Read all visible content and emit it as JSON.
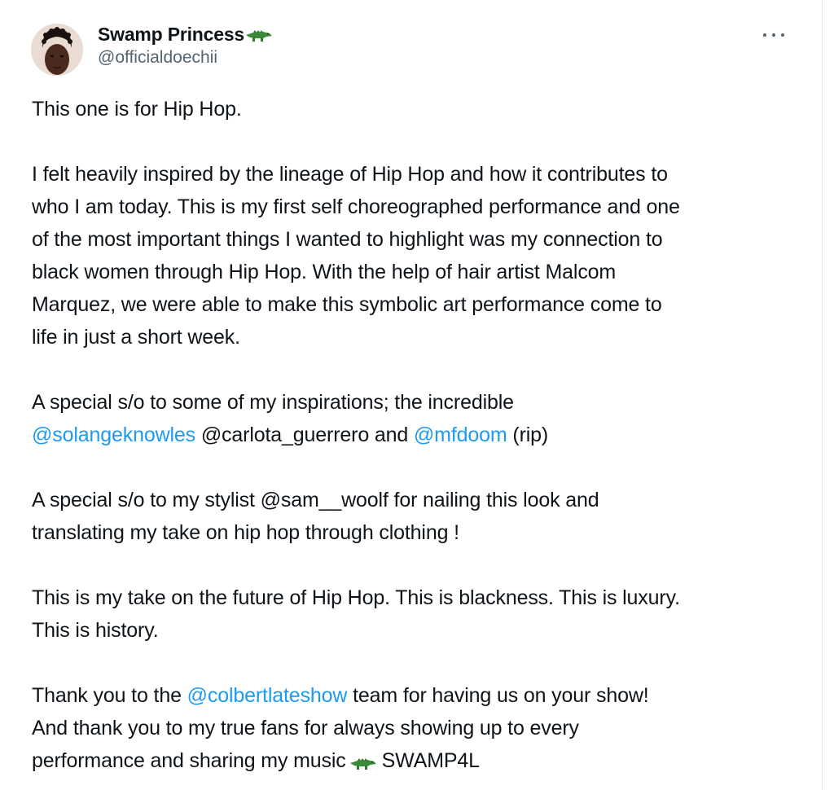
{
  "author": {
    "display_name": "Swamp Princess",
    "name_emoji": "crocodile-emoji-icon",
    "handle": "@officialdoechii"
  },
  "menu": {
    "more_icon": "more-horizontal-icon"
  },
  "tweet": {
    "p1": "This one is for Hip Hop.",
    "p2_lines": [
      "I felt heavily inspired by the lineage of Hip Hop and how it contributes to",
      "who I am today. This is my first self choreographed performance and one",
      "of the most important things I wanted to highlight was my connection to",
      "black women through Hip Hop. With the help of hair artist Malcom",
      "Marquez, we were able to make this symbolic art performance come to",
      "life in just a short week."
    ],
    "p3": {
      "line1": "A special s/o to some of my inspirations; the incredible",
      "mention1": "@solangeknowles",
      "text_mid": " @carlota_guerrero and ",
      "mention2": "@mfdoom",
      "text_end": " (rip)"
    },
    "p4_lines": [
      "A special s/o to my stylist @sam__woolf for nailing this look and",
      "translating my take on hip hop through clothing !"
    ],
    "p5_lines": [
      "This is my take on the future of Hip Hop. This is blackness. This is luxury.",
      "This is history."
    ],
    "p6": {
      "text_start": "Thank you to the ",
      "mention": "@colbertlateshow",
      "text_after_mention": " team for having us on your show!",
      "line2": "And thank you to my true fans for always showing up to every",
      "line3_start": "performance and sharing my music",
      "line3_end": "SWAMP4L"
    }
  },
  "colors": {
    "text": "#0f1419",
    "secondary": "#536471",
    "link": "#1d9bf0"
  }
}
